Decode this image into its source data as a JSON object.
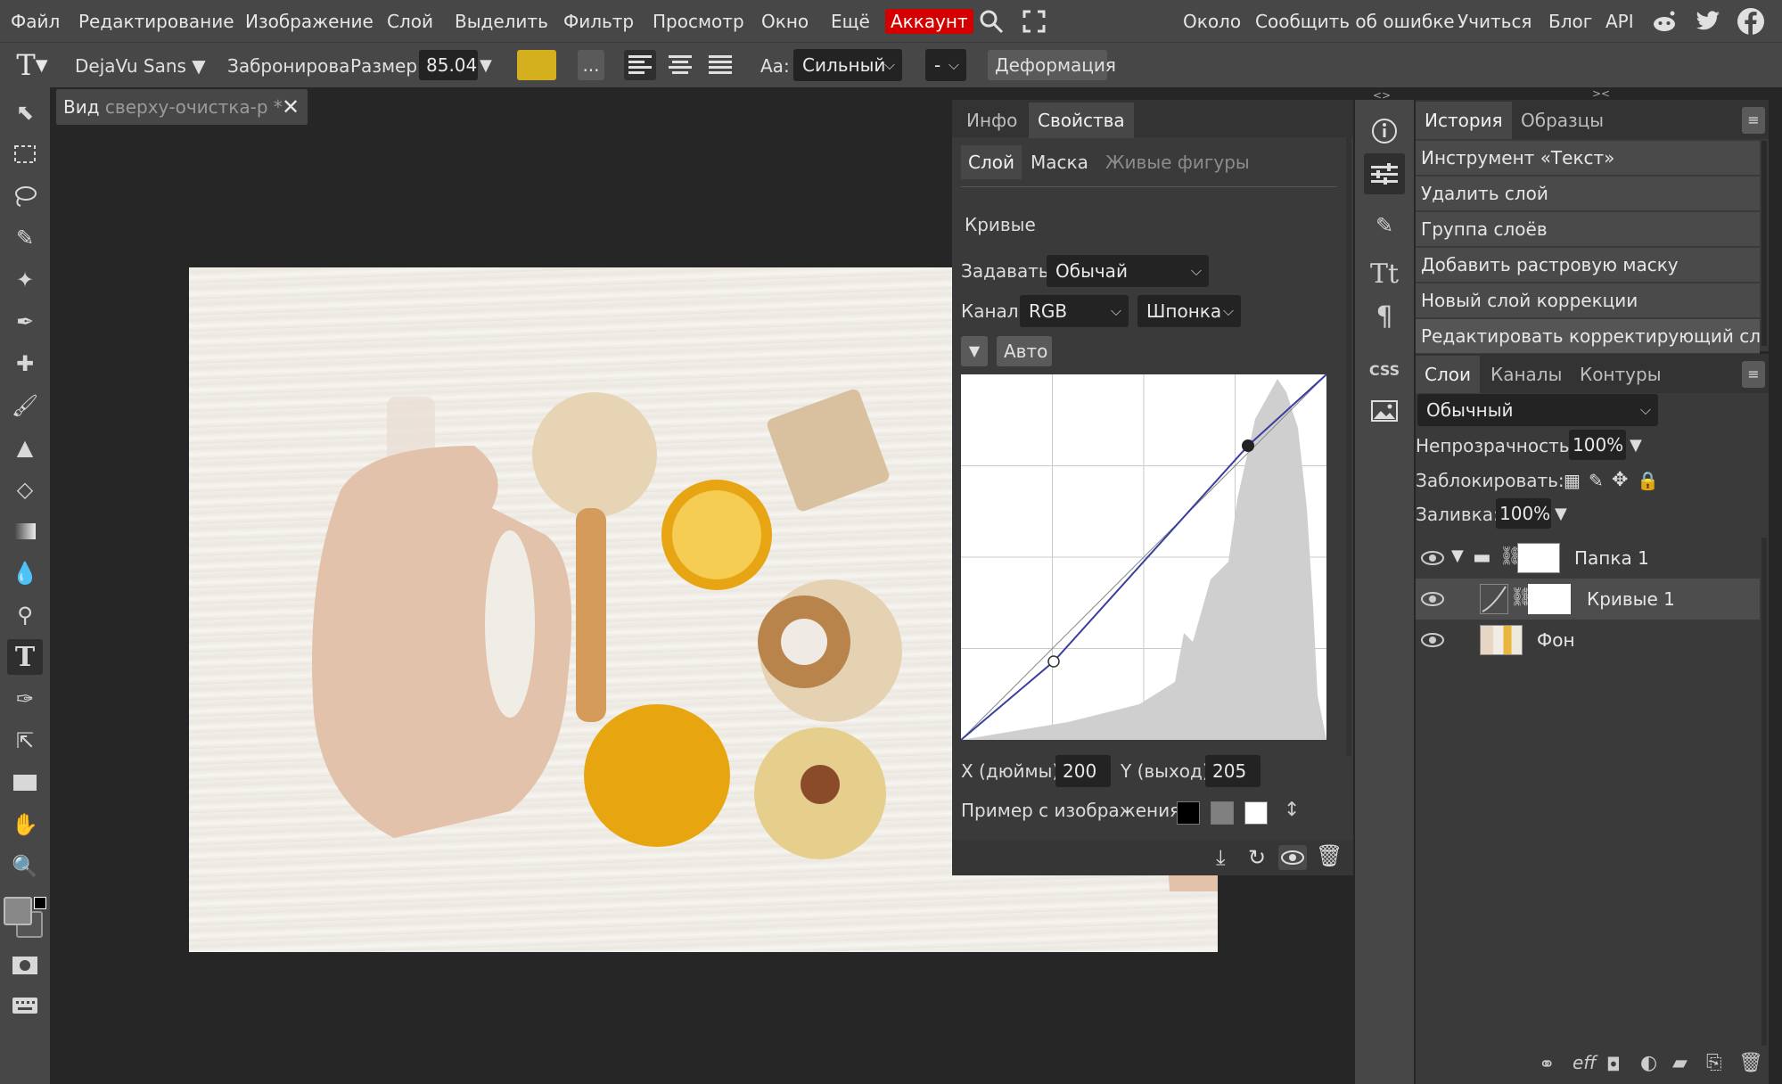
{
  "menu": {
    "items": [
      "Файл",
      "Редактирование",
      "Изображение",
      "Слой",
      "Выделить",
      "Фильтр",
      "Просмотр",
      "Окно",
      "Ещё"
    ],
    "account": "Аккаунт",
    "right_items": [
      "Около",
      "Сообщить об ошибке",
      "Учиться",
      "Блог",
      "API"
    ]
  },
  "options": {
    "font": "DejaVu Sans",
    "font_style": "Забронирова",
    "size_label": "Размер:",
    "size_value": "85.04",
    "color": "#d4af1e",
    "more": "...",
    "aa_label": "Aa:",
    "aa_value": "Сильный",
    "dash": "-",
    "warp": "Деформация"
  },
  "document": {
    "tab_prefix": "Вид",
    "tab_name": "сверху-очистка-р *"
  },
  "properties": {
    "tabs": [
      "Инфо",
      "Свойства"
    ],
    "subtabs": [
      "Слой",
      "Маска",
      "Живые фигуры"
    ],
    "section": "Кривые",
    "preset_label": "Задавать:",
    "preset_value": "Обычай",
    "channel_label": "Канал:",
    "channel_value": "RGB",
    "tool_value": "Шпонка",
    "auto": "Авто",
    "x_label": "X (дюймы):",
    "x_value": "200",
    "y_label": "Y (выход):",
    "y_value": "205",
    "sample_label": "Пример с изображения:"
  },
  "history": {
    "tabs": [
      "История",
      "Образцы"
    ],
    "items": [
      "Инструмент «Текст»",
      "Удалить слой",
      "Группа слоёв",
      "Добавить растровую маску",
      "Новый слой коррекции",
      "Редактировать корректирующий слой"
    ]
  },
  "layers": {
    "tabs": [
      "Слои",
      "Каналы",
      "Контуры"
    ],
    "blend": "Обычный",
    "opacity_label": "Непрозрачность:",
    "opacity_value": "100%",
    "lock_label": "Заблокировать:",
    "fill_label": "Заливка:",
    "fill_value": "100%",
    "items": [
      "Папка 1",
      "Кривые 1",
      "Фон"
    ]
  }
}
